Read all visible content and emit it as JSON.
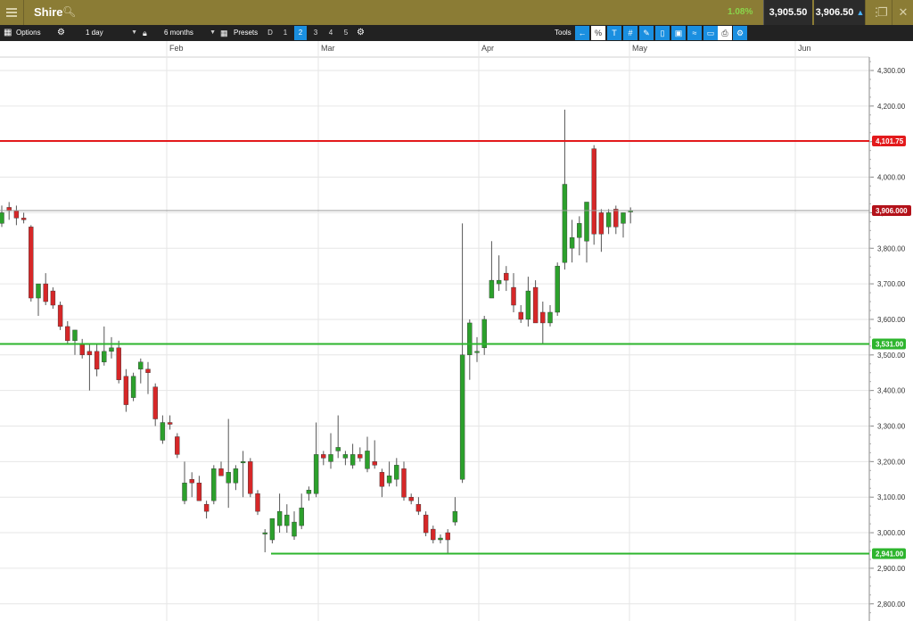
{
  "header": {
    "instrument": "Shire",
    "change_pct": "1.08%",
    "sell_price": "3,905.50",
    "buy_price": "3,906.50",
    "icons": {
      "menu": "hamburger-icon",
      "search": "search-icon",
      "grid": "grid-icon",
      "expand": "expand-icon",
      "close": "close-icon"
    }
  },
  "toolbar": {
    "options_label": "Options",
    "interval_label": "1 day",
    "range_label": "6 months",
    "presets_label": "Presets",
    "presets": [
      "D",
      "1",
      "2",
      "3",
      "4",
      "5"
    ],
    "active_preset": "2",
    "tools_label": "Tools",
    "tool_icons": [
      "back-arrow-icon",
      "percent-icon",
      "text-icon",
      "grid-lines-icon",
      "draw-icon",
      "candle-icon",
      "layers-icon",
      "indicator-icon",
      "shape-icon",
      "print-icon",
      "settings-icon"
    ]
  },
  "chart_data": {
    "type": "candlestick",
    "title": "",
    "xlabel": "",
    "ylabel": "",
    "ylim": [
      2750,
      4350
    ],
    "y_ticks": [
      "4,300.00",
      "4,200.00",
      "4,100.00",
      "4,000.00",
      "3,900.00",
      "3,800.00",
      "3,700.00",
      "3,600.00",
      "3,500.00",
      "3,400.00",
      "3,300.00",
      "3,200.00",
      "3,100.00",
      "3,000.00",
      "2,900.00",
      "2,800.00"
    ],
    "x_labels": [
      "Feb",
      "Mar",
      "Apr",
      "May",
      "Jun"
    ],
    "grid": true,
    "colors": {
      "up": "#2ca02c",
      "down": "#d62728",
      "resistance": "#e31a1c",
      "support": "#2db52d",
      "current": "#999999",
      "current_label": "#b3121a"
    },
    "levels": [
      {
        "name": "resistance",
        "value": 4101.75,
        "label": "4,101.75"
      },
      {
        "name": "support",
        "value": 3531.0,
        "label": "3,531.00"
      },
      {
        "name": "support",
        "value": 2941.0,
        "label": "2,941.00"
      },
      {
        "name": "current",
        "value": 3906.0,
        "label": "3,906.000"
      }
    ],
    "candles": [
      {
        "o": 3870,
        "h": 3920,
        "l": 3860,
        "c": 3900
      },
      {
        "o": 3915,
        "h": 3930,
        "l": 3880,
        "c": 3905
      },
      {
        "o": 3905,
        "h": 3920,
        "l": 3865,
        "c": 3885
      },
      {
        "o": 3885,
        "h": 3900,
        "l": 3870,
        "c": 3880
      },
      {
        "o": 3860,
        "h": 3865,
        "l": 3650,
        "c": 3660
      },
      {
        "o": 3660,
        "h": 3700,
        "l": 3610,
        "c": 3700
      },
      {
        "o": 3700,
        "h": 3730,
        "l": 3640,
        "c": 3650
      },
      {
        "o": 3680,
        "h": 3690,
        "l": 3630,
        "c": 3640
      },
      {
        "o": 3640,
        "h": 3650,
        "l": 3570,
        "c": 3580
      },
      {
        "o": 3580,
        "h": 3595,
        "l": 3530,
        "c": 3540
      },
      {
        "o": 3540,
        "h": 3570,
        "l": 3500,
        "c": 3570
      },
      {
        "o": 3530,
        "h": 3545,
        "l": 3490,
        "c": 3500
      },
      {
        "o": 3510,
        "h": 3530,
        "l": 3400,
        "c": 3500
      },
      {
        "o": 3510,
        "h": 3530,
        "l": 3440,
        "c": 3460
      },
      {
        "o": 3480,
        "h": 3580,
        "l": 3470,
        "c": 3510
      },
      {
        "o": 3510,
        "h": 3550,
        "l": 3490,
        "c": 3520
      },
      {
        "o": 3520,
        "h": 3540,
        "l": 3420,
        "c": 3430
      },
      {
        "o": 3440,
        "h": 3460,
        "l": 3340,
        "c": 3360
      },
      {
        "o": 3380,
        "h": 3450,
        "l": 3370,
        "c": 3440
      },
      {
        "o": 3460,
        "h": 3490,
        "l": 3420,
        "c": 3480
      },
      {
        "o": 3460,
        "h": 3480,
        "l": 3390,
        "c": 3450
      },
      {
        "o": 3410,
        "h": 3420,
        "l": 3300,
        "c": 3320
      },
      {
        "o": 3260,
        "h": 3330,
        "l": 3250,
        "c": 3310
      },
      {
        "o": 3310,
        "h": 3330,
        "l": 3290,
        "c": 3305
      },
      {
        "o": 3270,
        "h": 3280,
        "l": 3210,
        "c": 3220
      },
      {
        "o": 3090,
        "h": 3200,
        "l": 3080,
        "c": 3140
      },
      {
        "o": 3150,
        "h": 3170,
        "l": 3100,
        "c": 3140
      },
      {
        "o": 3140,
        "h": 3160,
        "l": 3090,
        "c": 3090
      },
      {
        "o": 3080,
        "h": 3090,
        "l": 3040,
        "c": 3060
      },
      {
        "o": 3090,
        "h": 3190,
        "l": 3080,
        "c": 3180
      },
      {
        "o": 3180,
        "h": 3200,
        "l": 3160,
        "c": 3160
      },
      {
        "o": 3140,
        "h": 3320,
        "l": 3070,
        "c": 3170
      },
      {
        "o": 3140,
        "h": 3190,
        "l": 3120,
        "c": 3180
      },
      {
        "o": 3200,
        "h": 3230,
        "l": 3100,
        "c": 3200
      },
      {
        "o": 3200,
        "h": 3210,
        "l": 3100,
        "c": 3110
      },
      {
        "o": 3110,
        "h": 3120,
        "l": 3050,
        "c": 3060
      },
      {
        "o": 3000,
        "h": 3010,
        "l": 2945,
        "c": 3000
      },
      {
        "o": 2980,
        "h": 3040,
        "l": 2970,
        "c": 3040
      },
      {
        "o": 3020,
        "h": 3110,
        "l": 3000,
        "c": 3060
      },
      {
        "o": 3020,
        "h": 3080,
        "l": 3000,
        "c": 3050
      },
      {
        "o": 2990,
        "h": 3060,
        "l": 2980,
        "c": 3030
      },
      {
        "o": 3020,
        "h": 3110,
        "l": 3010,
        "c": 3070
      },
      {
        "o": 3110,
        "h": 3130,
        "l": 3090,
        "c": 3120
      },
      {
        "o": 3110,
        "h": 3310,
        "l": 3100,
        "c": 3220
      },
      {
        "o": 3220,
        "h": 3230,
        "l": 3190,
        "c": 3210
      },
      {
        "o": 3200,
        "h": 3280,
        "l": 3180,
        "c": 3220
      },
      {
        "o": 3230,
        "h": 3330,
        "l": 3210,
        "c": 3240
      },
      {
        "o": 3210,
        "h": 3230,
        "l": 3190,
        "c": 3220
      },
      {
        "o": 3190,
        "h": 3250,
        "l": 3180,
        "c": 3220
      },
      {
        "o": 3220,
        "h": 3240,
        "l": 3200,
        "c": 3210
      },
      {
        "o": 3180,
        "h": 3270,
        "l": 3170,
        "c": 3230
      },
      {
        "o": 3200,
        "h": 3260,
        "l": 3180,
        "c": 3190
      },
      {
        "o": 3170,
        "h": 3180,
        "l": 3100,
        "c": 3130
      },
      {
        "o": 3140,
        "h": 3200,
        "l": 3130,
        "c": 3160
      },
      {
        "o": 3150,
        "h": 3210,
        "l": 3130,
        "c": 3190
      },
      {
        "o": 3180,
        "h": 3200,
        "l": 3090,
        "c": 3100
      },
      {
        "o": 3100,
        "h": 3110,
        "l": 3080,
        "c": 3090
      },
      {
        "o": 3080,
        "h": 3100,
        "l": 3050,
        "c": 3060
      },
      {
        "o": 3050,
        "h": 3060,
        "l": 2990,
        "c": 3000
      },
      {
        "o": 3010,
        "h": 3020,
        "l": 2970,
        "c": 2980
      },
      {
        "o": 2980,
        "h": 2995,
        "l": 2970,
        "c": 2985
      },
      {
        "o": 3000,
        "h": 3010,
        "l": 2940,
        "c": 2980
      },
      {
        "o": 3030,
        "h": 3100,
        "l": 3020,
        "c": 3060
      },
      {
        "o": 3150,
        "h": 3870,
        "l": 3140,
        "c": 3500
      },
      {
        "o": 3500,
        "h": 3600,
        "l": 3430,
        "c": 3590
      },
      {
        "o": 3510,
        "h": 3550,
        "l": 3480,
        "c": 3510
      },
      {
        "o": 3520,
        "h": 3610,
        "l": 3500,
        "c": 3600
      },
      {
        "o": 3660,
        "h": 3820,
        "l": 3660,
        "c": 3710
      },
      {
        "o": 3700,
        "h": 3780,
        "l": 3680,
        "c": 3710
      },
      {
        "o": 3730,
        "h": 3750,
        "l": 3680,
        "c": 3710
      },
      {
        "o": 3690,
        "h": 3730,
        "l": 3620,
        "c": 3640
      },
      {
        "o": 3620,
        "h": 3640,
        "l": 3590,
        "c": 3600
      },
      {
        "o": 3600,
        "h": 3720,
        "l": 3580,
        "c": 3680
      },
      {
        "o": 3690,
        "h": 3710,
        "l": 3590,
        "c": 3590
      },
      {
        "o": 3620,
        "h": 3650,
        "l": 3530,
        "c": 3590
      },
      {
        "o": 3590,
        "h": 3640,
        "l": 3580,
        "c": 3620
      },
      {
        "o": 3620,
        "h": 3760,
        "l": 3610,
        "c": 3750
      },
      {
        "o": 3760,
        "h": 4190,
        "l": 3740,
        "c": 3980
      },
      {
        "o": 3800,
        "h": 3880,
        "l": 3760,
        "c": 3830
      },
      {
        "o": 3830,
        "h": 3890,
        "l": 3780,
        "c": 3870
      },
      {
        "o": 3820,
        "h": 3930,
        "l": 3760,
        "c": 3930
      },
      {
        "o": 4080,
        "h": 4090,
        "l": 3810,
        "c": 3840
      },
      {
        "o": 3900,
        "h": 3910,
        "l": 3790,
        "c": 3840
      },
      {
        "o": 3860,
        "h": 3910,
        "l": 3840,
        "c": 3900
      },
      {
        "o": 3910,
        "h": 3920,
        "l": 3840,
        "c": 3860
      },
      {
        "o": 3870,
        "h": 3900,
        "l": 3830,
        "c": 3900
      },
      {
        "o": 3905,
        "h": 3915,
        "l": 3870,
        "c": 3906
      }
    ]
  }
}
